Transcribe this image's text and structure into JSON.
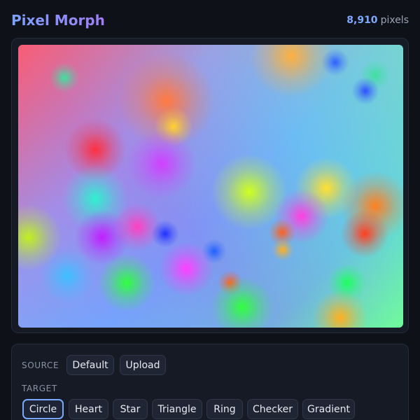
{
  "header": {
    "title": "Pixel Morph",
    "pixel_count": "8,910",
    "pixel_unit": "pixels"
  },
  "controls": {
    "source_label": "SOURCE",
    "source_buttons": [
      "Default",
      "Upload"
    ],
    "target_label": "TARGET",
    "target_buttons": [
      "Circle",
      "Heart",
      "Star",
      "Triangle",
      "Ring",
      "Checker",
      "Gradient"
    ],
    "target_selected": "Circle"
  },
  "colors": {
    "accent": "#7aa8ff",
    "background": "#0e1117",
    "panel": "#151a24"
  }
}
